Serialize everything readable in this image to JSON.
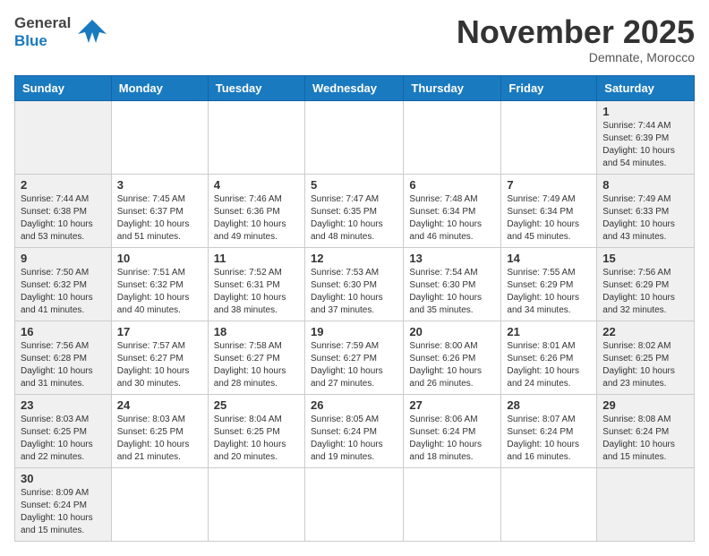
{
  "header": {
    "logo_general": "General",
    "logo_blue": "Blue",
    "month_title": "November 2025",
    "location": "Demnate, Morocco"
  },
  "weekdays": [
    "Sunday",
    "Monday",
    "Tuesday",
    "Wednesday",
    "Thursday",
    "Friday",
    "Saturday"
  ],
  "weeks": [
    [
      {
        "day": "",
        "info": ""
      },
      {
        "day": "",
        "info": ""
      },
      {
        "day": "",
        "info": ""
      },
      {
        "day": "",
        "info": ""
      },
      {
        "day": "",
        "info": ""
      },
      {
        "day": "",
        "info": ""
      },
      {
        "day": "1",
        "info": "Sunrise: 7:44 AM\nSunset: 6:39 PM\nDaylight: 10 hours\nand 54 minutes."
      }
    ],
    [
      {
        "day": "2",
        "info": "Sunrise: 7:44 AM\nSunset: 6:38 PM\nDaylight: 10 hours\nand 53 minutes."
      },
      {
        "day": "3",
        "info": "Sunrise: 7:45 AM\nSunset: 6:37 PM\nDaylight: 10 hours\nand 51 minutes."
      },
      {
        "day": "4",
        "info": "Sunrise: 7:46 AM\nSunset: 6:36 PM\nDaylight: 10 hours\nand 49 minutes."
      },
      {
        "day": "5",
        "info": "Sunrise: 7:47 AM\nSunset: 6:35 PM\nDaylight: 10 hours\nand 48 minutes."
      },
      {
        "day": "6",
        "info": "Sunrise: 7:48 AM\nSunset: 6:34 PM\nDaylight: 10 hours\nand 46 minutes."
      },
      {
        "day": "7",
        "info": "Sunrise: 7:49 AM\nSunset: 6:34 PM\nDaylight: 10 hours\nand 45 minutes."
      },
      {
        "day": "8",
        "info": "Sunrise: 7:49 AM\nSunset: 6:33 PM\nDaylight: 10 hours\nand 43 minutes."
      }
    ],
    [
      {
        "day": "9",
        "info": "Sunrise: 7:50 AM\nSunset: 6:32 PM\nDaylight: 10 hours\nand 41 minutes."
      },
      {
        "day": "10",
        "info": "Sunrise: 7:51 AM\nSunset: 6:32 PM\nDaylight: 10 hours\nand 40 minutes."
      },
      {
        "day": "11",
        "info": "Sunrise: 7:52 AM\nSunset: 6:31 PM\nDaylight: 10 hours\nand 38 minutes."
      },
      {
        "day": "12",
        "info": "Sunrise: 7:53 AM\nSunset: 6:30 PM\nDaylight: 10 hours\nand 37 minutes."
      },
      {
        "day": "13",
        "info": "Sunrise: 7:54 AM\nSunset: 6:30 PM\nDaylight: 10 hours\nand 35 minutes."
      },
      {
        "day": "14",
        "info": "Sunrise: 7:55 AM\nSunset: 6:29 PM\nDaylight: 10 hours\nand 34 minutes."
      },
      {
        "day": "15",
        "info": "Sunrise: 7:56 AM\nSunset: 6:29 PM\nDaylight: 10 hours\nand 32 minutes."
      }
    ],
    [
      {
        "day": "16",
        "info": "Sunrise: 7:56 AM\nSunset: 6:28 PM\nDaylight: 10 hours\nand 31 minutes."
      },
      {
        "day": "17",
        "info": "Sunrise: 7:57 AM\nSunset: 6:27 PM\nDaylight: 10 hours\nand 30 minutes."
      },
      {
        "day": "18",
        "info": "Sunrise: 7:58 AM\nSunset: 6:27 PM\nDaylight: 10 hours\nand 28 minutes."
      },
      {
        "day": "19",
        "info": "Sunrise: 7:59 AM\nSunset: 6:27 PM\nDaylight: 10 hours\nand 27 minutes."
      },
      {
        "day": "20",
        "info": "Sunrise: 8:00 AM\nSunset: 6:26 PM\nDaylight: 10 hours\nand 26 minutes."
      },
      {
        "day": "21",
        "info": "Sunrise: 8:01 AM\nSunset: 6:26 PM\nDaylight: 10 hours\nand 24 minutes."
      },
      {
        "day": "22",
        "info": "Sunrise: 8:02 AM\nSunset: 6:25 PM\nDaylight: 10 hours\nand 23 minutes."
      }
    ],
    [
      {
        "day": "23",
        "info": "Sunrise: 8:03 AM\nSunset: 6:25 PM\nDaylight: 10 hours\nand 22 minutes."
      },
      {
        "day": "24",
        "info": "Sunrise: 8:03 AM\nSunset: 6:25 PM\nDaylight: 10 hours\nand 21 minutes."
      },
      {
        "day": "25",
        "info": "Sunrise: 8:04 AM\nSunset: 6:25 PM\nDaylight: 10 hours\nand 20 minutes."
      },
      {
        "day": "26",
        "info": "Sunrise: 8:05 AM\nSunset: 6:24 PM\nDaylight: 10 hours\nand 19 minutes."
      },
      {
        "day": "27",
        "info": "Sunrise: 8:06 AM\nSunset: 6:24 PM\nDaylight: 10 hours\nand 18 minutes."
      },
      {
        "day": "28",
        "info": "Sunrise: 8:07 AM\nSunset: 6:24 PM\nDaylight: 10 hours\nand 16 minutes."
      },
      {
        "day": "29",
        "info": "Sunrise: 8:08 AM\nSunset: 6:24 PM\nDaylight: 10 hours\nand 15 minutes."
      }
    ],
    [
      {
        "day": "30",
        "info": "Sunrise: 8:09 AM\nSunset: 6:24 PM\nDaylight: 10 hours\nand 15 minutes."
      },
      {
        "day": "",
        "info": ""
      },
      {
        "day": "",
        "info": ""
      },
      {
        "day": "",
        "info": ""
      },
      {
        "day": "",
        "info": ""
      },
      {
        "day": "",
        "info": ""
      },
      {
        "day": "",
        "info": ""
      }
    ]
  ]
}
